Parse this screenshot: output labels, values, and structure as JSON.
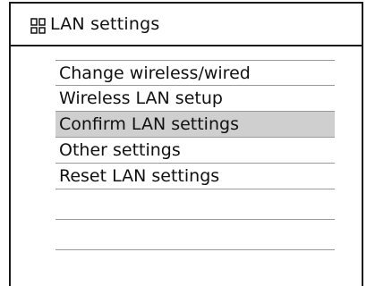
{
  "header": {
    "title": "LAN settings",
    "icon": "network-settings-icon"
  },
  "menu": {
    "items": [
      {
        "label": "Change wireless/wired"
      },
      {
        "label": "Wireless LAN setup"
      },
      {
        "label": "Confirm LAN settings",
        "selected": true
      },
      {
        "label": "Other settings"
      },
      {
        "label": "Reset LAN settings"
      }
    ],
    "selected_index": 2
  },
  "colors": {
    "selection": "#cfcfcf",
    "border": "#1a1a1a"
  }
}
